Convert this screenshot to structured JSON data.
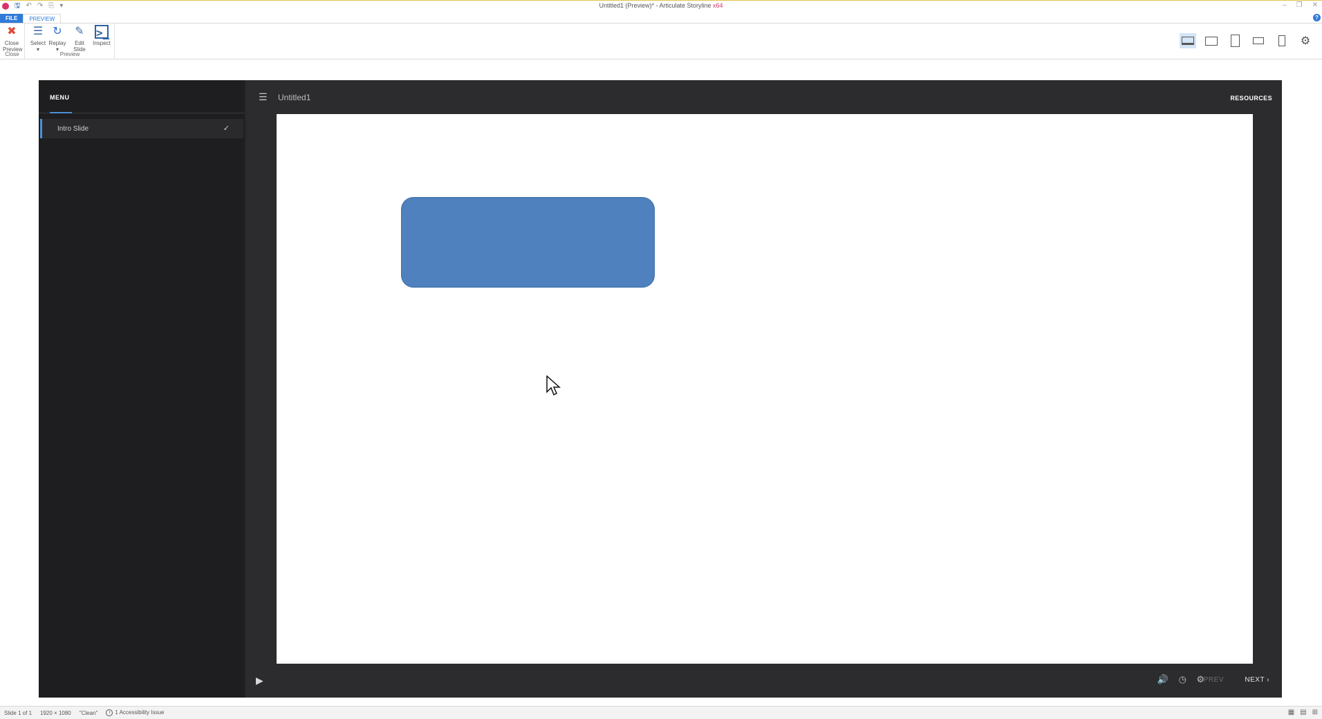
{
  "window": {
    "title": "Untitled1 (Preview)* - Articulate Storyline",
    "arch": "x64",
    "controls": [
      "–",
      "❐",
      "✕"
    ]
  },
  "ribbon": {
    "tabs": {
      "file": "FILE",
      "preview": "PREVIEW"
    },
    "close_group": {
      "button_label_1": "Close",
      "button_label_2": "Preview",
      "group_label": "Close"
    },
    "preview_group": {
      "select_label": "Select",
      "replay_label": "Replay",
      "edit_label_1": "Edit",
      "edit_label_2": "Slide",
      "inspect_label": "Inspect",
      "group_label": "Preview"
    },
    "help": "?"
  },
  "player": {
    "menu_title": "MENU",
    "menu_items": [
      {
        "label": "Intro Slide",
        "check": "✓"
      }
    ],
    "course_title": "Untitled1",
    "resources_label": "RESOURCES",
    "prev_label": "PREV",
    "next_label": "NEXT",
    "colors": {
      "shape_fill": "#4e81bd",
      "accent": "#4a90d9",
      "player_bg": "#2c2c2e"
    }
  },
  "statusbar": {
    "slide": "Slide 1 of 1",
    "size": "1920 × 1080",
    "theme": "\"Clean\"",
    "accessibility": "1 Accessibility Issue"
  }
}
